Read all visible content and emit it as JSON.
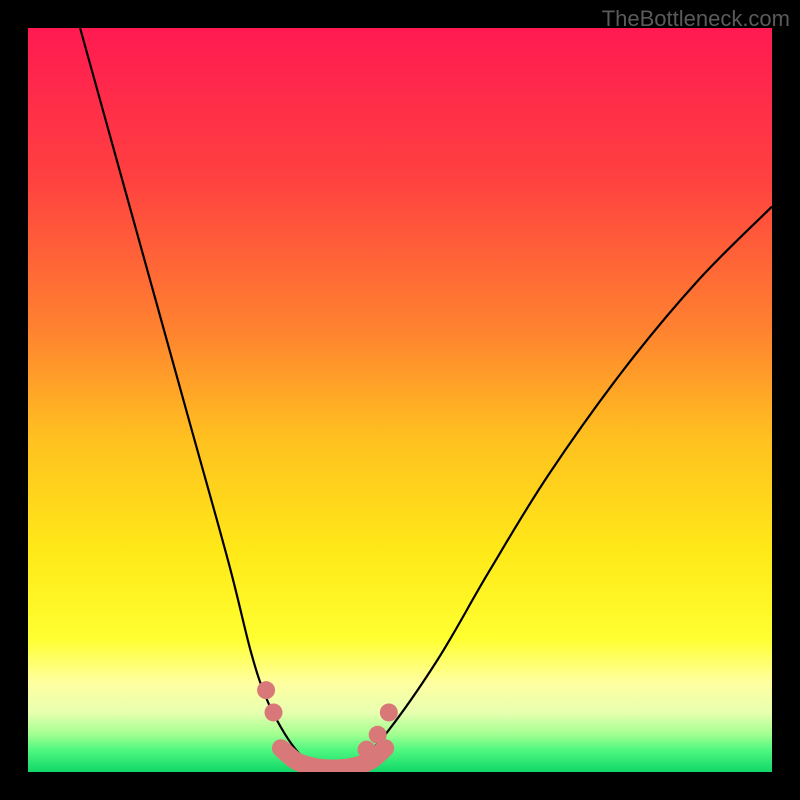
{
  "watermark": "TheBottleneck.com",
  "chart_data": {
    "type": "line",
    "title": "",
    "xlabel": "",
    "ylabel": "",
    "xlim": [
      0,
      100
    ],
    "ylim": [
      0,
      100
    ],
    "series": [
      {
        "name": "left-curve",
        "x": [
          7,
          12,
          17,
          22,
          27,
          30,
          32,
          34,
          36,
          38
        ],
        "y": [
          100,
          82,
          64,
          46,
          28,
          16,
          10,
          6,
          3,
          1
        ]
      },
      {
        "name": "right-curve",
        "x": [
          44,
          48,
          55,
          62,
          70,
          80,
          90,
          100
        ],
        "y": [
          1,
          5,
          15,
          27,
          40,
          54,
          66,
          76
        ]
      },
      {
        "name": "bottom-segment",
        "x": [
          34,
          36,
          38,
          40,
          42,
          44,
          46,
          48
        ],
        "y": [
          3.2,
          1.5,
          0.8,
          0.5,
          0.5,
          0.8,
          1.5,
          3.2
        ]
      }
    ],
    "markers": {
      "left": [
        {
          "x": 32.0,
          "y": 11.0
        },
        {
          "x": 33.0,
          "y": 8.0
        }
      ],
      "right": [
        {
          "x": 45.5,
          "y": 3.0
        },
        {
          "x": 47.0,
          "y": 5.0
        },
        {
          "x": 48.5,
          "y": 8.0
        }
      ]
    },
    "gradient_stops": [
      {
        "offset": 0,
        "color": "#ff1a52"
      },
      {
        "offset": 20,
        "color": "#ff4040"
      },
      {
        "offset": 40,
        "color": "#ff8030"
      },
      {
        "offset": 55,
        "color": "#ffc020"
      },
      {
        "offset": 70,
        "color": "#ffe818"
      },
      {
        "offset": 82,
        "color": "#ffff30"
      },
      {
        "offset": 88,
        "color": "#ffffa0"
      },
      {
        "offset": 92,
        "color": "#e8ffb0"
      },
      {
        "offset": 95,
        "color": "#a0ff90"
      },
      {
        "offset": 97,
        "color": "#50f880"
      },
      {
        "offset": 100,
        "color": "#10d868"
      }
    ],
    "marker_color": "#d87878",
    "curve_color": "#000000"
  }
}
